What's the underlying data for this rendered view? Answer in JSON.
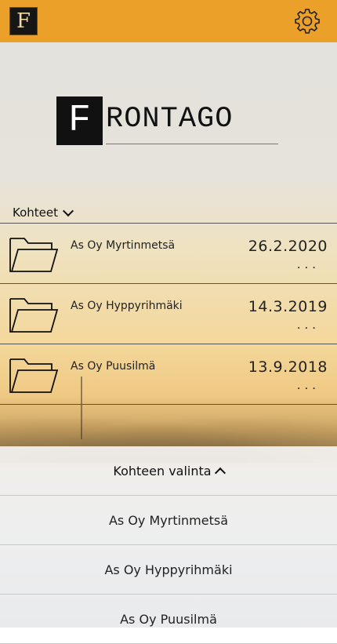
{
  "topbar": {
    "logo_letter": "F",
    "settings_icon": "gear-icon",
    "color": "#eba02a"
  },
  "brand": {
    "box_letter": "F",
    "rest": "RONTAGO"
  },
  "section": {
    "label": "Kohteet"
  },
  "items": [
    {
      "name": "As Oy Myrtinmetsä",
      "date": "26.2.2020",
      "more": "..."
    },
    {
      "name": "As Oy Hyppyrihmäki",
      "date": "14.3.2019",
      "more": "..."
    },
    {
      "name": "As Oy Puusilmä",
      "date": "13.9.2018",
      "more": "..."
    }
  ],
  "picker": {
    "title": "Kohteen valinta",
    "options": [
      "As Oy Myrtinmetsä",
      "As Oy Hyppyrihmäki",
      "As Oy Puusilmä"
    ]
  }
}
